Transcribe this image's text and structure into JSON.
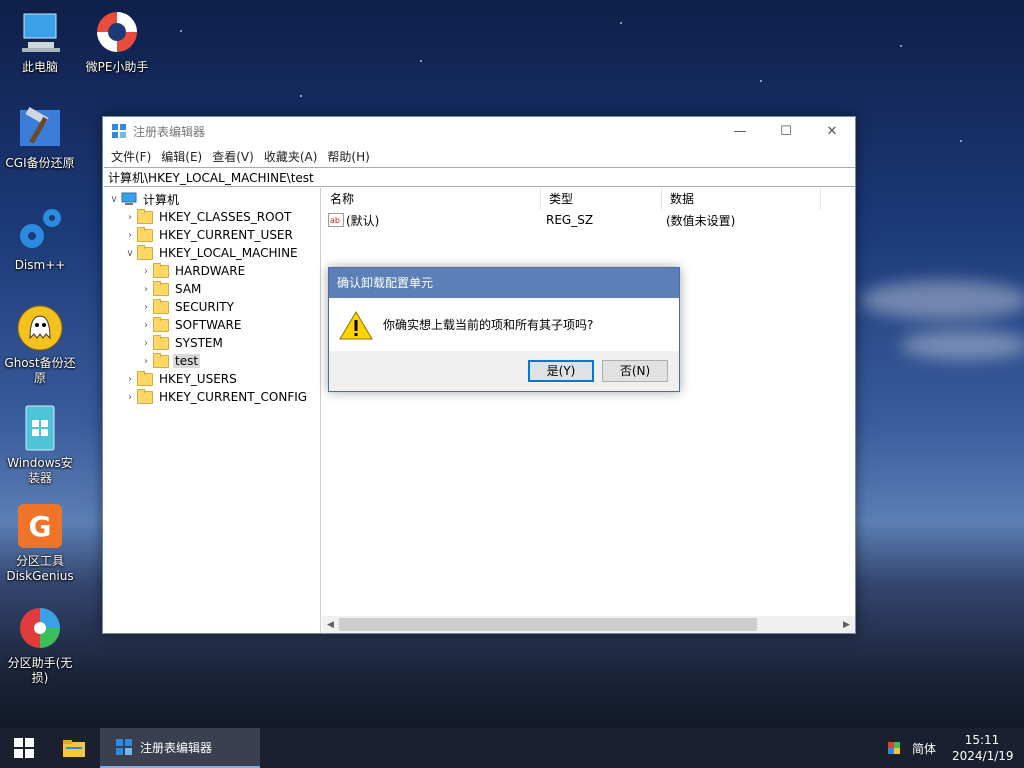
{
  "desktop": {
    "icons": [
      {
        "label": "此电脑",
        "icon": "computer-icon"
      },
      {
        "label": "微PE小助手",
        "icon": "lifebuoy-icon"
      },
      {
        "label": "CGI备份还原",
        "icon": "hammer-icon"
      },
      {
        "label": "Dism++",
        "icon": "gears-icon"
      },
      {
        "label": "Ghost备份还原",
        "icon": "ghost-icon"
      },
      {
        "label": "Windows安装器",
        "icon": "windows-installer-icon"
      },
      {
        "label": "分区工具DiskGenius",
        "icon": "diskgenius-icon"
      },
      {
        "label": "分区助手(无损)",
        "icon": "partition-assistant-icon"
      }
    ]
  },
  "window": {
    "title": "注册表编辑器",
    "menu": [
      "文件(F)",
      "编辑(E)",
      "查看(V)",
      "收藏夹(A)",
      "帮助(H)"
    ],
    "address": "计算机\\HKEY_LOCAL_MACHINE\\test",
    "tree": {
      "root": "计算机",
      "hives": [
        "HKEY_CLASSES_ROOT",
        "HKEY_CURRENT_USER",
        "HKEY_LOCAL_MACHINE"
      ],
      "hklm_children": [
        "HARDWARE",
        "SAM",
        "SECURITY",
        "SOFTWARE",
        "SYSTEM",
        "test"
      ],
      "hives_after": [
        "HKEY_USERS",
        "HKEY_CURRENT_CONFIG"
      ]
    },
    "list": {
      "columns": [
        "名称",
        "类型",
        "数据"
      ],
      "rows": [
        {
          "name": "(默认)",
          "type": "REG_SZ",
          "data": "(数值未设置)"
        }
      ]
    }
  },
  "dialog": {
    "title": "确认卸载配置单元",
    "message": "你确实想上载当前的项和所有其子项吗?",
    "yes": "是(Y)",
    "no": "否(N)"
  },
  "taskbar": {
    "active_app": "注册表编辑器",
    "ime": "简体",
    "time": "15:11",
    "date": "2024/1/19"
  },
  "colors": {
    "dialog_title_bg": "#5b7fb6",
    "taskbar_bg": "#1b2030",
    "accent": "#0078d7"
  }
}
